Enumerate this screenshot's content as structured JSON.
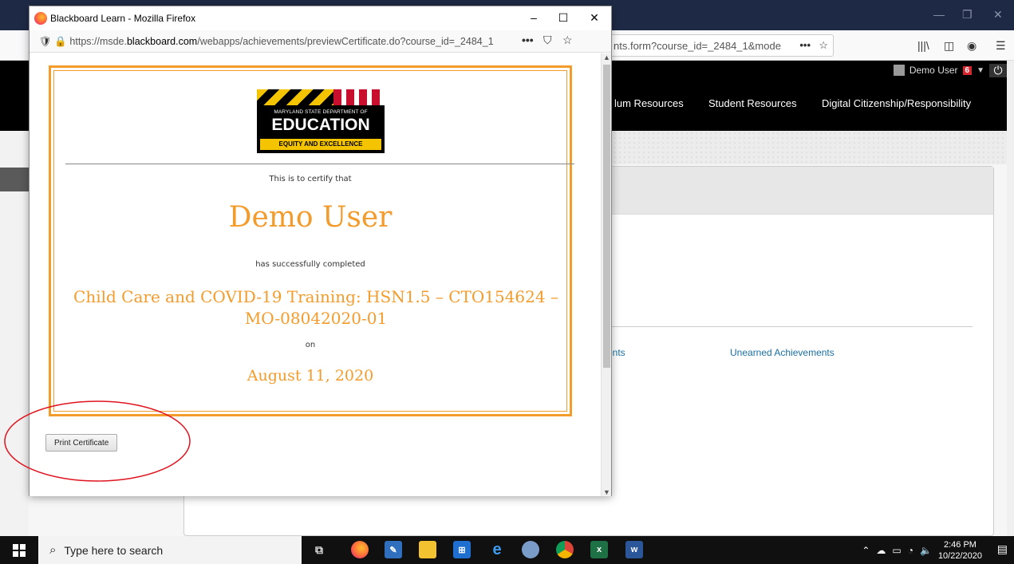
{
  "background_window": {
    "url_fragment": "nts.form?course_id=_2484_1&mode",
    "url_more": "•••",
    "user_name": "Demo User",
    "user_badge": "6",
    "nav": [
      "lum Resources",
      "Student Resources",
      "Digital Citizenship/Responsibility"
    ],
    "links": [
      "ments",
      "Unearned Achievements"
    ]
  },
  "popup": {
    "title": "Blackboard Learn - Mozilla Firefox",
    "url_prefix": "https://msde.",
    "url_host": "blackboard.com",
    "url_path": "/webapps/achievements/previewCertificate.do?course_id=_2484_1",
    "url_more": "•••",
    "controls": {
      "minimize": "–",
      "maximize": "☐",
      "close": "✕"
    }
  },
  "logo": {
    "dept": "MARYLAND STATE DEPARTMENT OF",
    "main": "EDUCATION",
    "tagline": "EQUITY AND EXCELLENCE"
  },
  "certificate": {
    "certify_text": "This is to certify that",
    "recipient": "Demo User",
    "completed_text": "has successfully completed",
    "course": "Child Care and COVID-19 Training: HSN1.5 – CTO154624 – MO-08042020-01",
    "on_text": "on",
    "date": "August 11, 2020"
  },
  "print_button": "Print Certificate",
  "taskbar": {
    "search_placeholder": "Type here to search",
    "time": "2:46 PM",
    "date": "10/22/2020"
  },
  "colors": {
    "certificate_orange": "#f39b2b",
    "annotation_red": "#e0141e",
    "titlebar_dark": "#1e2a45"
  }
}
